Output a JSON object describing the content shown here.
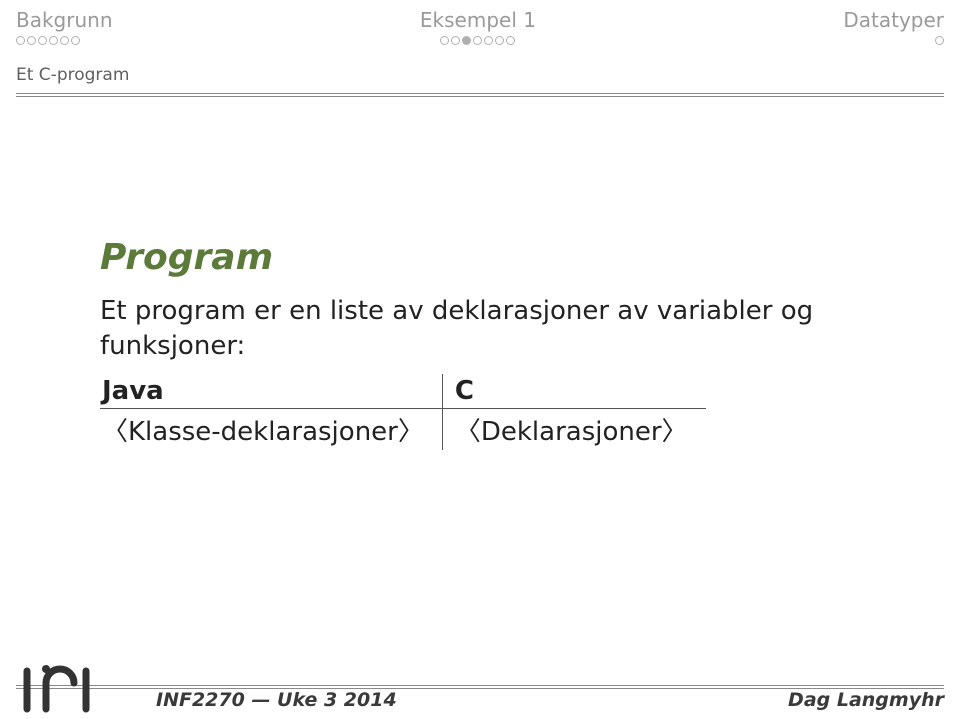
{
  "nav": {
    "left": {
      "label": "Bakgrunn",
      "total": 6,
      "active": -1
    },
    "center": {
      "label": "Eksempel 1",
      "total": 7,
      "active": 2
    },
    "right": {
      "label": "Datatyper",
      "total": 1,
      "active": -1
    }
  },
  "subsection": "Et C-program",
  "content": {
    "title": "Program",
    "body": "Et program er en liste av deklarasjoner av variabler og funksjoner:",
    "table": {
      "h1": "Java",
      "h2": "C",
      "r1": "〈Klasse-deklarasjoner〉",
      "r2": "〈Deklarasjoner〉"
    }
  },
  "footer": {
    "left": "INF2270 — Uke 3 2014",
    "right": "Dag Langmyhr"
  }
}
